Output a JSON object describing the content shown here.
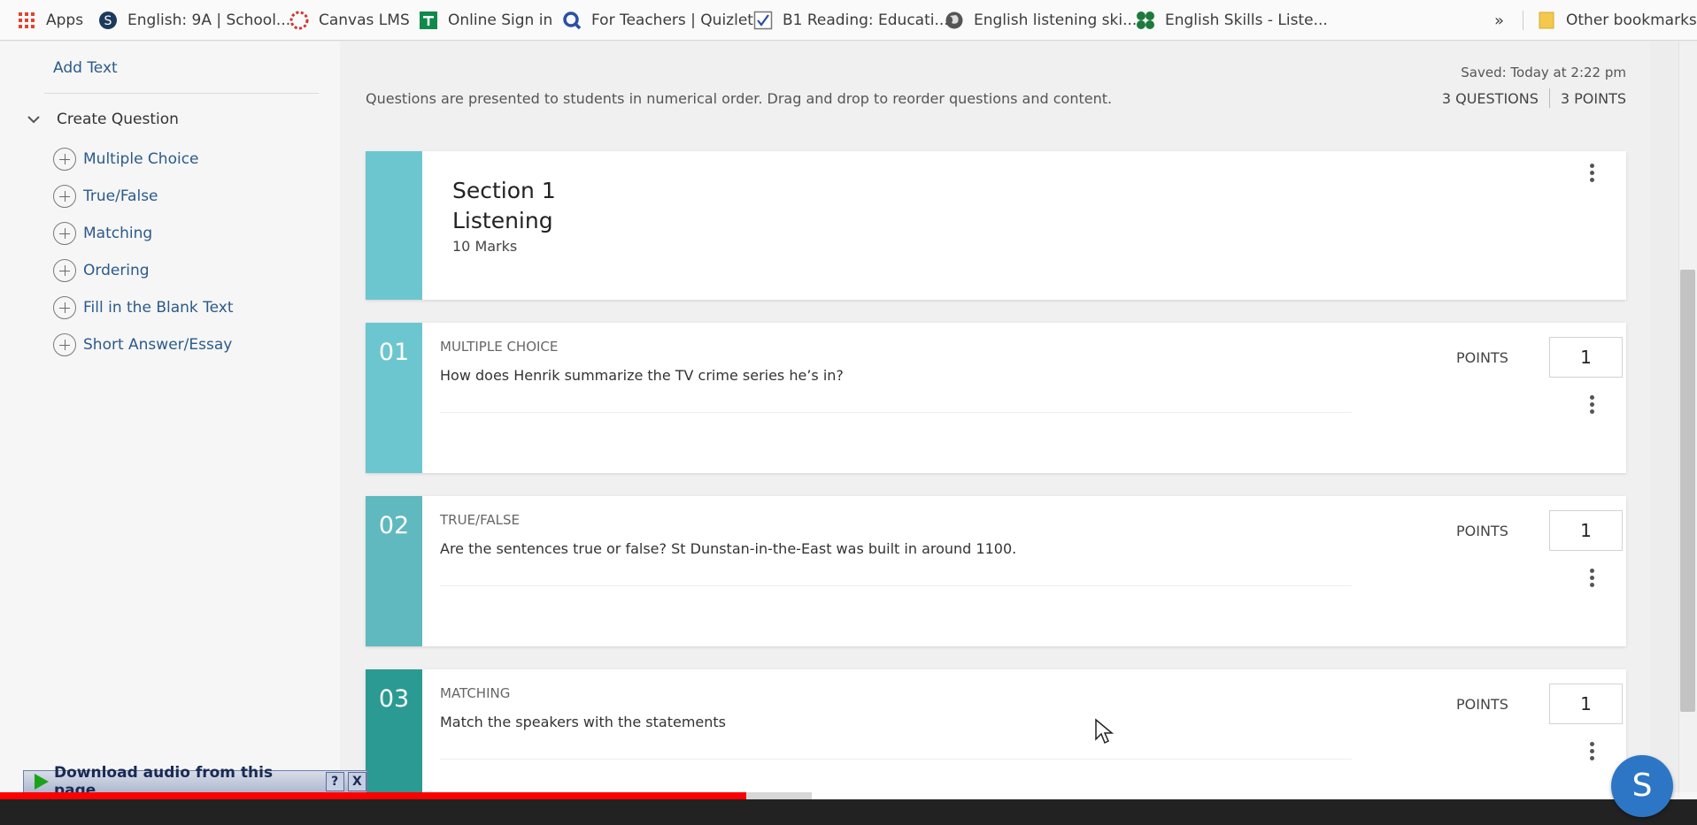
{
  "bookmarks": [
    {
      "label": "Apps",
      "icon": "apps-grid-icon"
    },
    {
      "label": "English: 9A | School...",
      "icon": "schoology-icon"
    },
    {
      "label": "Canvas LMS",
      "icon": "canvas-icon"
    },
    {
      "label": "Online Sign in",
      "icon": "sign-in-icon"
    },
    {
      "label": "For Teachers | Quizlet",
      "icon": "quizlet-icon"
    },
    {
      "label": "B1 Reading: Educati...",
      "icon": "check-icon"
    },
    {
      "label": "English listening ski...",
      "icon": "globe-icon"
    },
    {
      "label": "English Skills - Liste...",
      "icon": "clover-icon"
    }
  ],
  "bookmarks_more": "»",
  "other_bookmarks": "Other bookmarks",
  "sidebar": {
    "add_text": "Add Text",
    "create_question": "Create Question",
    "question_types": [
      "Multiple Choice",
      "True/False",
      "Matching",
      "Ordering",
      "Fill in the Blank Text",
      "Short Answer/Essay"
    ]
  },
  "header": {
    "saved": "Saved: Today at 2:22 pm",
    "instructions": "Questions are presented to students in numerical order. Drag and drop to reorder questions and content.",
    "questions_count": "3 QUESTIONS",
    "points_count": "3 POINTS"
  },
  "section": {
    "title_line1": "Section 1",
    "title_line2": "Listening",
    "marks": "10 Marks"
  },
  "points_label": "POINTS",
  "questions": [
    {
      "number": "01",
      "type": "MULTIPLE CHOICE",
      "text": "How does Henrik summarize the TV crime series he’s in?",
      "points": "1"
    },
    {
      "number": "02",
      "type": "TRUE/FALSE",
      "text": "Are the sentences true or false? St Dunstan-in-the-East was built in around 1100.",
      "points": "1"
    },
    {
      "number": "03",
      "type": "MATCHING",
      "text": "Match the speakers with the statements",
      "points": "1"
    }
  ],
  "overlay": {
    "download_audio": "Download audio from this page",
    "help": "?",
    "close": "X",
    "avatar_letter": "S",
    "video_progress": 0.44
  },
  "colors": {
    "teal": "#6cc6cf",
    "teal_dark": "#2b9a93",
    "link": "#2b5a8a",
    "progress": "#ff0000"
  }
}
